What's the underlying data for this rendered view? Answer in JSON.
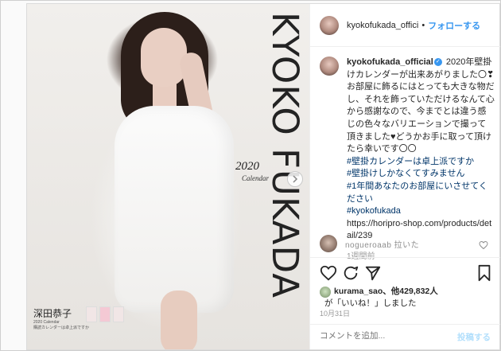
{
  "media": {
    "title": "KYOKO FUKADA",
    "year": "2020",
    "subtitle": "Calendar",
    "footer_name": "深田恭子",
    "footer_sub": "2020 Calendar",
    "footer_small": "購読カレンダーは卓上派ですか"
  },
  "header": {
    "username": "kyokofukada_offici",
    "separator": "•",
    "follow_label": "フォローする"
  },
  "caption": {
    "username": "kyokofukada_official",
    "verified_glyph": "✓",
    "lines": [
      "2020年壁掛けカレンダーが出来あがりました〇❣お部屋に飾るにはとっても大きな物だし、それを飾っていただけるなんて心から感謝なので、今までとは違う感じの色々なバリエーションで撮って頂きました♥どうかお手に取って頂けたら幸いです〇〇"
    ],
    "hashtags": [
      "#壁掛カレンダーは卓上派ですか",
      "#壁掛けしかなくてすみません",
      "#1年間あなたのお部屋にいさせてください",
      "#kyokofukada"
    ],
    "link": "https://horipro-shop.com/products/detail/239",
    "time_ago": "1週間前"
  },
  "comment": {
    "text": "nogueroaab 拉いた"
  },
  "likes": {
    "user": "kurama_sao",
    "count_text": "、他429,832人",
    "suffix": "が「いいね！」しました"
  },
  "date": "10月31日",
  "comment_box": {
    "placeholder": "コメントを追加...",
    "post_label": "投稿する"
  },
  "icons": {
    "next": "chevron-right-icon",
    "heart": "heart-icon",
    "comment": "comment-icon",
    "share": "share-icon",
    "save": "bookmark-icon"
  },
  "colors": {
    "accent": "#3897f0",
    "link": "#003569",
    "muted": "#999999"
  }
}
